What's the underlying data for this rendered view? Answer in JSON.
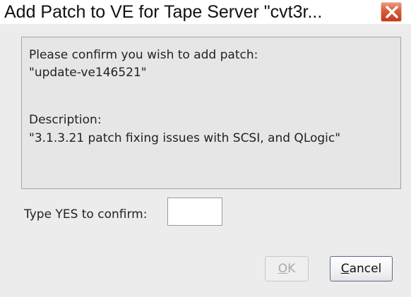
{
  "window": {
    "title": "Add Patch to VE for Tape Server \"cvt3r..."
  },
  "message": {
    "confirm_line": "Please confirm you wish to add patch:",
    "patch_name": "\"update-ve146521\"",
    "description_label": "Description:",
    "description_text": "\"3.1.3.21 patch fixing issues with SCSI, and QLogic\""
  },
  "confirm": {
    "label": "Type YES to confirm:",
    "value": "",
    "placeholder": ""
  },
  "buttons": {
    "ok": {
      "mnemonic": "O",
      "rest": "K",
      "enabled": false
    },
    "cancel": {
      "mnemonic": "C",
      "rest": "ancel",
      "enabled": true
    }
  },
  "colors": {
    "close_button": "#d75b3a",
    "panel_background": "#e6e6e6",
    "dialog_background": "#ececec",
    "disabled_text": "#a8a8a8"
  },
  "icons": {
    "close": "close-icon"
  }
}
